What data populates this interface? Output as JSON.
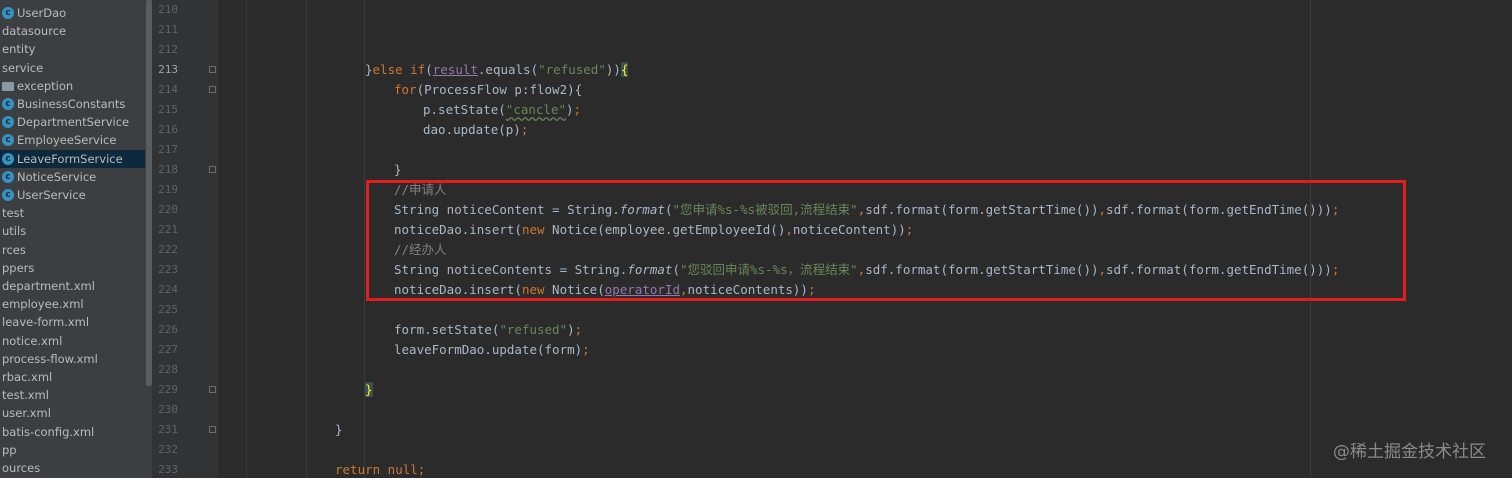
{
  "project_tree": {
    "items": [
      {
        "label": "UserDao",
        "icon": "class-icon",
        "selected": false
      },
      {
        "label": "datasource",
        "icon": "none",
        "selected": false
      },
      {
        "label": "entity",
        "icon": "none",
        "selected": false
      },
      {
        "label": "service",
        "icon": "none",
        "selected": false
      },
      {
        "label": "exception",
        "icon": "folder-icon",
        "selected": false
      },
      {
        "label": "BusinessConstants",
        "icon": "class-icon",
        "selected": false
      },
      {
        "label": "DepartmentService",
        "icon": "class-icon",
        "selected": false
      },
      {
        "label": "EmployeeService",
        "icon": "class-icon",
        "selected": false
      },
      {
        "label": "LeaveFormService",
        "icon": "class-icon",
        "selected": true
      },
      {
        "label": "NoticeService",
        "icon": "class-icon",
        "selected": false
      },
      {
        "label": "UserService",
        "icon": "class-icon",
        "selected": false
      },
      {
        "label": "test",
        "icon": "none",
        "selected": false
      },
      {
        "label": "utils",
        "icon": "none",
        "selected": false
      },
      {
        "label": "rces",
        "icon": "none",
        "selected": false
      },
      {
        "label": "ppers",
        "icon": "none",
        "selected": false
      },
      {
        "label": "department.xml",
        "icon": "none",
        "selected": false
      },
      {
        "label": "employee.xml",
        "icon": "none",
        "selected": false
      },
      {
        "label": "leave-form.xml",
        "icon": "none",
        "selected": false
      },
      {
        "label": "notice.xml",
        "icon": "none",
        "selected": false
      },
      {
        "label": "process-flow.xml",
        "icon": "none",
        "selected": false
      },
      {
        "label": "rbac.xml",
        "icon": "none",
        "selected": false
      },
      {
        "label": "test.xml",
        "icon": "none",
        "selected": false
      },
      {
        "label": "user.xml",
        "icon": "none",
        "selected": false
      },
      {
        "label": "batis-config.xml",
        "icon": "none",
        "selected": false
      },
      {
        "label": "pp",
        "icon": "none",
        "selected": false
      },
      {
        "label": "ources",
        "icon": "none",
        "selected": false
      }
    ]
  },
  "editor": {
    "line_numbers": [
      "210",
      "211",
      "212",
      "213",
      "214",
      "215",
      "216",
      "217",
      "218",
      "219",
      "220",
      "221",
      "222",
      "223",
      "224",
      "225",
      "226",
      "227",
      "228",
      "229",
      "230",
      "231",
      "232",
      "233"
    ],
    "current_line": "213",
    "lines": [
      [],
      [],
      [],
      [
        {
          "t": "}",
          "c": "p"
        },
        {
          "t": "else if",
          "c": "kw"
        },
        {
          "t": "(",
          "c": "p"
        },
        {
          "t": "result",
          "c": "fld ul"
        },
        {
          "t": ".equals(",
          "c": "p"
        },
        {
          "t": "\"refused\"",
          "c": "str"
        },
        {
          "t": "))",
          "c": "p"
        },
        {
          "t": "{",
          "c": "brace-hl"
        }
      ],
      [
        {
          "t": "for",
          "c": "kw"
        },
        {
          "t": "(ProcessFlow p:flow2){",
          "c": "p"
        }
      ],
      [
        {
          "t": "p.setState(",
          "c": "p"
        },
        {
          "t": "\"cancle\"",
          "c": "str wavy"
        },
        {
          "t": ")",
          "c": "p"
        },
        {
          "t": ";",
          "c": "kw"
        }
      ],
      [
        {
          "t": "dao.update(p)",
          "c": "p"
        },
        {
          "t": ";",
          "c": "kw"
        }
      ],
      [],
      [
        {
          "t": "}",
          "c": "p"
        }
      ],
      [
        {
          "t": "//申请人",
          "c": "cm"
        }
      ],
      [
        {
          "t": "String noticeContent = String.",
          "c": "p"
        },
        {
          "t": "format",
          "c": "it"
        },
        {
          "t": "(",
          "c": "p"
        },
        {
          "t": "\"您申请%s-%s被驳回,流程结束\"",
          "c": "str"
        },
        {
          "t": ",",
          "c": "kw"
        },
        {
          "t": "sdf.format(form.getStartTime())",
          "c": "p"
        },
        {
          "t": ",",
          "c": "kw"
        },
        {
          "t": "sdf.format(form.getEndTime()))",
          "c": "p"
        },
        {
          "t": ";",
          "c": "kw"
        }
      ],
      [
        {
          "t": "noticeDao.insert(",
          "c": "p"
        },
        {
          "t": "new ",
          "c": "kw"
        },
        {
          "t": "Notice(employee.getEmployeeId()",
          "c": "p"
        },
        {
          "t": ",",
          "c": "kw"
        },
        {
          "t": "noticeContent))",
          "c": "p"
        },
        {
          "t": ";",
          "c": "kw"
        }
      ],
      [
        {
          "t": "//经办人",
          "c": "cm"
        }
      ],
      [
        {
          "t": "String noticeContents = String.",
          "c": "p"
        },
        {
          "t": "format",
          "c": "it"
        },
        {
          "t": "(",
          "c": "p"
        },
        {
          "t": "\"您驳回申请%s-%s，流程结束\"",
          "c": "str"
        },
        {
          "t": ",",
          "c": "kw"
        },
        {
          "t": "sdf.format(form.getStartTime())",
          "c": "p"
        },
        {
          "t": ",",
          "c": "kw"
        },
        {
          "t": "sdf.format(form.getEndTime()))",
          "c": "p"
        },
        {
          "t": ";",
          "c": "kw"
        }
      ],
      [
        {
          "t": "noticeDao.insert(",
          "c": "p"
        },
        {
          "t": "new ",
          "c": "kw"
        },
        {
          "t": "Notice(",
          "c": "p"
        },
        {
          "t": "operatorId",
          "c": "fld ul"
        },
        {
          "t": ",",
          "c": "kw"
        },
        {
          "t": "noticeContents))",
          "c": "p"
        },
        {
          "t": ";",
          "c": "kw"
        }
      ],
      [],
      [
        {
          "t": "form.setState(",
          "c": "p"
        },
        {
          "t": "\"refused\"",
          "c": "str"
        },
        {
          "t": ")",
          "c": "p"
        },
        {
          "t": ";",
          "c": "kw"
        }
      ],
      [
        {
          "t": "leaveFormDao.update(form)",
          "c": "p"
        },
        {
          "t": ";",
          "c": "kw"
        }
      ],
      [],
      [
        {
          "t": "}",
          "c": "brace-hl"
        }
      ],
      [],
      [
        {
          "t": "}",
          "c": "p"
        }
      ],
      [],
      [
        {
          "t": "return null",
          "c": "kw"
        },
        {
          "t": ";",
          "c": "kw"
        }
      ]
    ]
  },
  "watermark": "@稀土掘金技术社区",
  "colors": {
    "keyword": "#cc7832",
    "string": "#6a8759",
    "comment": "#808080",
    "field": "#9876aa",
    "highlight_box": "#e11d1d"
  }
}
